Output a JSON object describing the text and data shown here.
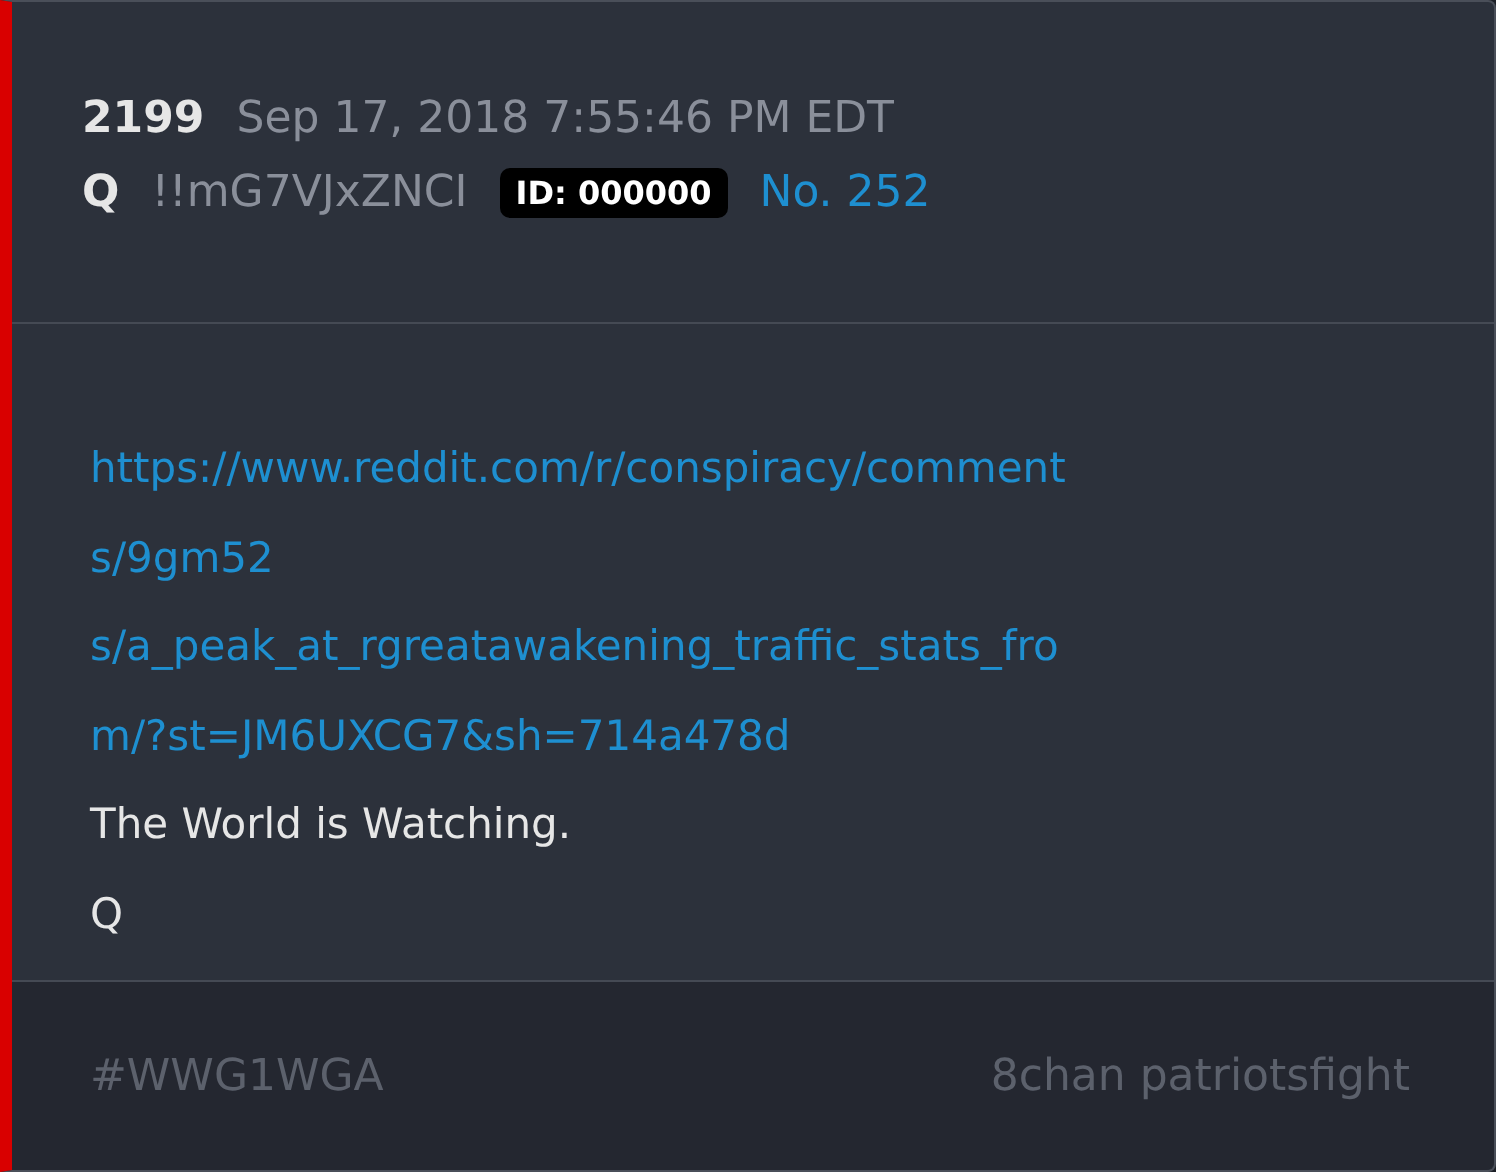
{
  "post": {
    "number": "2199",
    "timestamp": "Sep 17, 2018 7:55:46 PM EDT",
    "author": "Q",
    "tripcode": "!!mG7VJxZNCI",
    "id_badge": "ID: 000000",
    "post_no": "No. 252"
  },
  "body": {
    "link_lines": [
      "https://www.reddit.com/r/conspiracy/comment",
      "s/9gm52",
      "s/a_peak_at_rgreatawakening_traffic_stats_fro",
      "m/?st=JM6UXCG7&sh=714a478d"
    ],
    "text_lines": [
      "The World is Watching.",
      "Q"
    ]
  },
  "footer": {
    "tag": "#WWG1WGA",
    "source": "8chan patriotsfight"
  }
}
